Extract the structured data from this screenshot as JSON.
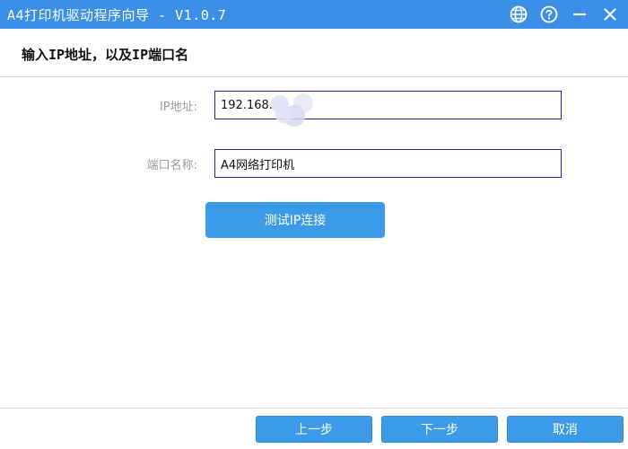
{
  "window": {
    "title": "A4打印机驱动程序向导 - V1.0.7",
    "icons": [
      "globe-icon",
      "help-icon",
      "minimize-icon",
      "close-icon"
    ]
  },
  "header": {
    "heading": "输入IP地址，以及IP端口名"
  },
  "form": {
    "ip_label": "IP地址:",
    "ip_value": "192.168.",
    "port_label": "端口名称:",
    "port_value": "A4网络打印机"
  },
  "actions": {
    "test_button": "测试IP连接"
  },
  "footer": {
    "prev_label": "上一步",
    "next_label": "下一步",
    "cancel_label": "取消"
  },
  "colors": {
    "titlebar": "#3b8fe6",
    "button": "#3b9be8",
    "field_border": "#2b2b8f",
    "label": "#9b9b9b"
  }
}
